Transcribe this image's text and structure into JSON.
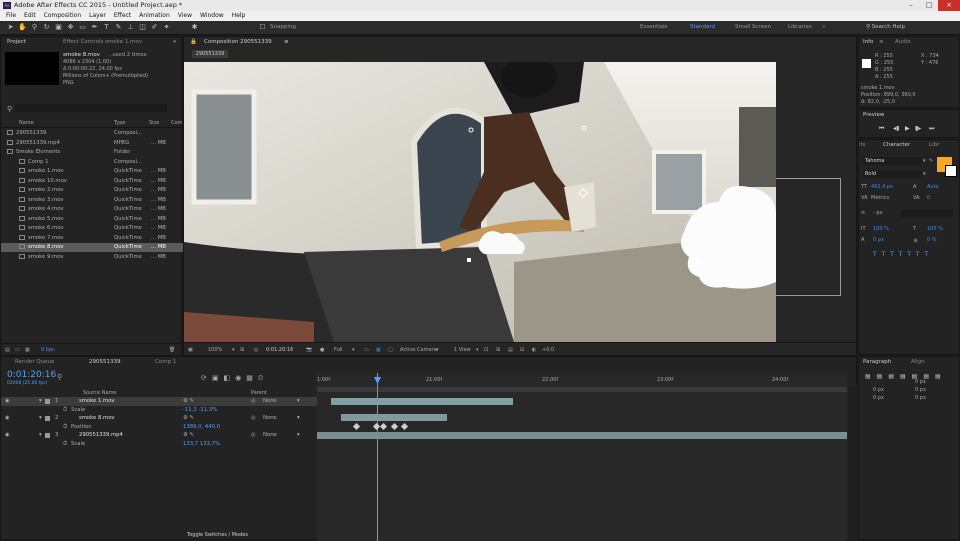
{
  "window": {
    "title": "Adobe After Effects CC 2015 - Untitled Project.aep *"
  },
  "menu": [
    "File",
    "Edit",
    "Composition",
    "Layer",
    "Effect",
    "Animation",
    "View",
    "Window",
    "Help"
  ],
  "toolbar": {
    "snapping": "Snapping",
    "workspaces": [
      "Essentials",
      "Standard",
      "Small Screen",
      "Libraries"
    ],
    "active_workspace": "Standard",
    "search": "Search Help"
  },
  "project": {
    "tab": "Project",
    "tab2": "Effect Controls smoke 1.mov",
    "selected_name": "smoke 8.mov",
    "used": ", used 2 times",
    "dims": "4086 x 2304 (1,00)",
    "duration": "Δ 0:00:00:22, 24,00 fps",
    "colors": "Millions of Colors+ (Premultiplied)",
    "format": "PNG",
    "columns": [
      "Name",
      "Type",
      "Size",
      "Com"
    ],
    "items": [
      {
        "name": "290551339",
        "type": "Composi...",
        "size": "",
        "indent": 0,
        "sel": false
      },
      {
        "name": "290551339.mp4",
        "type": "MPEG",
        "size": "... MB",
        "indent": 0,
        "sel": false
      },
      {
        "name": "Smoke Elements",
        "type": "Folder",
        "size": "",
        "indent": 0,
        "sel": false
      },
      {
        "name": "Comp 1",
        "type": "Composi...",
        "size": "",
        "indent": 1,
        "sel": false
      },
      {
        "name": "smoke 1.mov",
        "type": "QuickTime",
        "size": "... MB",
        "indent": 1,
        "sel": false
      },
      {
        "name": "smoke 10.mov",
        "type": "QuickTime",
        "size": "... MB",
        "indent": 1,
        "sel": false
      },
      {
        "name": "smoke 2.mov",
        "type": "QuickTime",
        "size": "... MB",
        "indent": 1,
        "sel": false
      },
      {
        "name": "smoke 3.mov",
        "type": "QuickTime",
        "size": "... MB",
        "indent": 1,
        "sel": false
      },
      {
        "name": "smoke 4.mov",
        "type": "QuickTime",
        "size": "... MB",
        "indent": 1,
        "sel": false
      },
      {
        "name": "smoke 5.mov",
        "type": "QuickTime",
        "size": "... MB",
        "indent": 1,
        "sel": false
      },
      {
        "name": "smoke 6.mov",
        "type": "QuickTime",
        "size": "... MB",
        "indent": 1,
        "sel": false
      },
      {
        "name": "smoke 7.mov",
        "type": "QuickTime",
        "size": "... MB",
        "indent": 1,
        "sel": false
      },
      {
        "name": "smoke 8.mov",
        "type": "QuickTime",
        "size": "... MB",
        "indent": 1,
        "sel": true
      },
      {
        "name": "smoke 9.mov",
        "type": "QuickTime",
        "size": "... MB",
        "indent": 1,
        "sel": false
      }
    ],
    "bpc": "8 bpc"
  },
  "comp": {
    "tab": "Composition 290551339",
    "subtab": "290551339",
    "zoom": "100%",
    "timecode": "0:01:20:16",
    "quality": "Full",
    "camera": "Active Camera",
    "view": "1 View",
    "exposure": "+0,0"
  },
  "info": {
    "tab": "Info",
    "tab2": "Audio",
    "r": "R : 255",
    "g": "G : 255",
    "b": "B : 255",
    "a": "A : 255",
    "x": "X : 734",
    "y": "Y : 476",
    "layer": "smoke 1.mov",
    "position": "Position: 899,0, 360,0",
    "delta": "Δ: 82,0, -25,0"
  },
  "preview": {
    "tab": "Preview"
  },
  "character": {
    "tab": "Character",
    "tab2": "Libr",
    "side": "its",
    "font": "Tahoma",
    "style": "Bold",
    "size": "492,4 px",
    "leading": "Auto",
    "kerning": "Metrics",
    "tracking": "0",
    "stroke": "- px",
    "vscale": "100 %",
    "hscale": "100 %",
    "baseline": "0 px",
    "tsume": "0 %",
    "fill_color": "#f7a823"
  },
  "paragraph": {
    "tab": "Paragraph",
    "tab2": "Align",
    "vals": [
      "0 px",
      "0 px",
      "0 px",
      "0 px",
      "0 px"
    ]
  },
  "timeline": {
    "tab1": "Render Queue",
    "tab2": "290551339",
    "tab3": "Comp 1",
    "timecode": "0:01:20:16",
    "frame": "02008 (25.00 fps)",
    "ticks": [
      "1:00f",
      "21:00f",
      "22:00f",
      "23:00f",
      "24:00f"
    ],
    "col_source": "Source Name",
    "col_parent": "Parent",
    "toggle": "Toggle Switches / Modes",
    "layers": [
      {
        "num": "1",
        "name": "smoke 1.mov",
        "parent": "None",
        "type": "layer",
        "sel": true
      },
      {
        "num": "",
        "name": "Scale",
        "value": "-11,3 -11,3%",
        "type": "prop"
      },
      {
        "num": "2",
        "name": "smoke 8.mov",
        "parent": "None",
        "type": "layer",
        "sel": false
      },
      {
        "num": "",
        "name": "Position",
        "value": "1389,0, 440,0",
        "type": "prop"
      },
      {
        "num": "3",
        "name": "290551339.mp4",
        "parent": "None",
        "type": "layer",
        "sel": false
      },
      {
        "num": "",
        "name": "Scale",
        "value": "133,7 133,7%",
        "type": "prop"
      }
    ]
  }
}
